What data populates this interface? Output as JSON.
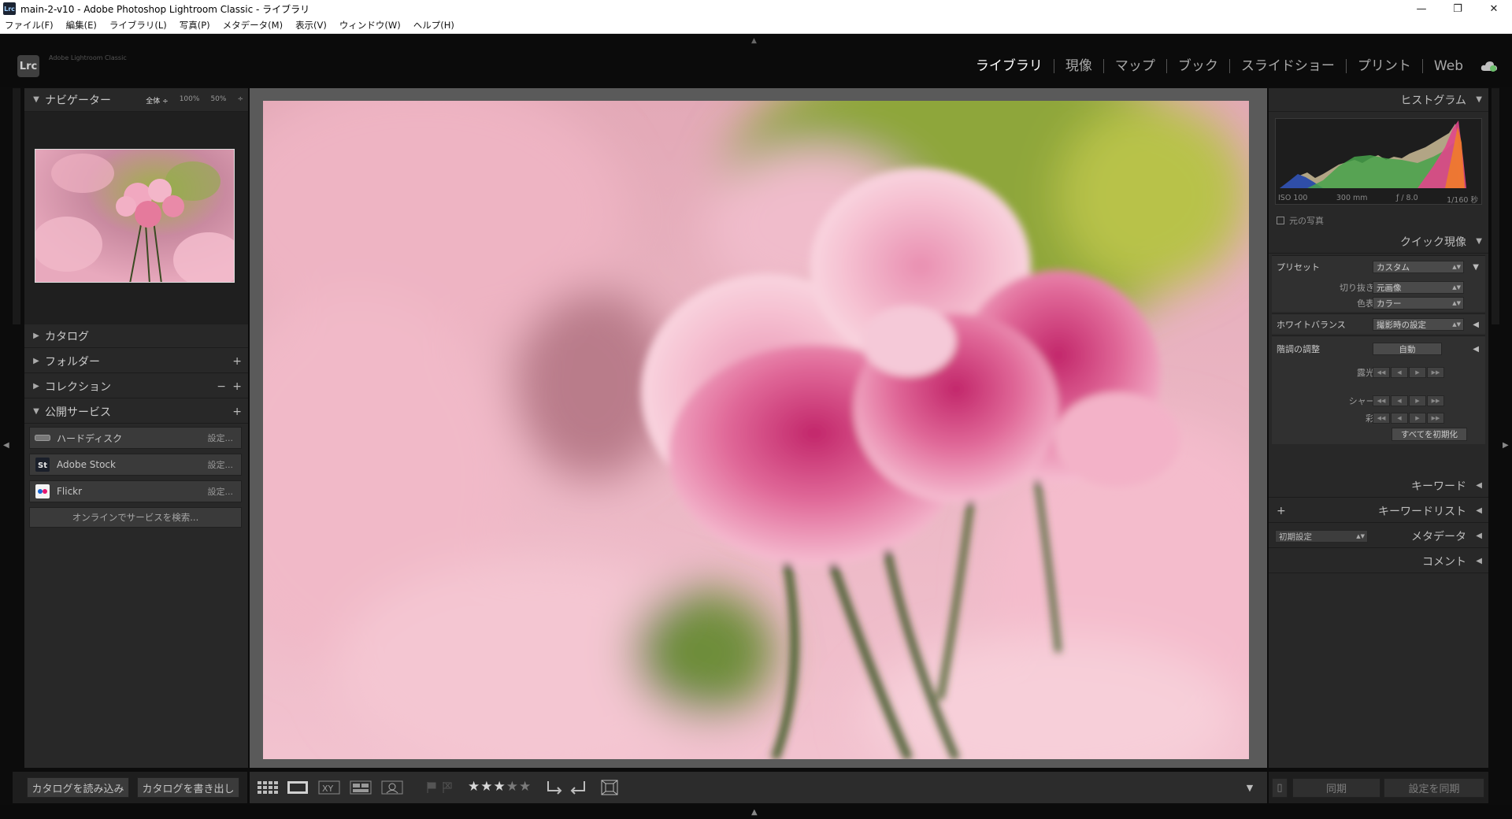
{
  "window": {
    "title": "main-2-v10 - Adobe Photoshop Lightroom Classic - ライブラリ",
    "app_icon": "Lrc",
    "minimize": "—",
    "maximize": "❐",
    "close": "✕"
  },
  "menu": [
    "ファイル(F)",
    "編集(E)",
    "ライブラリ(L)",
    "写真(P)",
    "メタデータ(M)",
    "表示(V)",
    "ウィンドウ(W)",
    "ヘルプ(H)"
  ],
  "identity": {
    "badge": "Lrc",
    "subtitle": "Adobe Lightroom Classic"
  },
  "modules": [
    {
      "label": "ライブラリ",
      "active": true
    },
    {
      "label": "現像",
      "active": false
    },
    {
      "label": "マップ",
      "active": false
    },
    {
      "label": "ブック",
      "active": false
    },
    {
      "label": "スライドショー",
      "active": false
    },
    {
      "label": "プリント",
      "active": false
    },
    {
      "label": "Web",
      "active": false
    }
  ],
  "left": {
    "navigator": {
      "title": "ナビゲーター",
      "zoom_fit": "全体 ÷",
      "zoom_100": "100%",
      "zoom_50": "50%",
      "zoom_arrow": "÷"
    },
    "catalog": "カタログ",
    "folders": "フォルダー",
    "collections": "コレクション",
    "publish": "公開サービス",
    "services": [
      {
        "name": "ハードディスク",
        "setting": "設定..."
      },
      {
        "name": "Adobe Stock",
        "setting": "設定..."
      },
      {
        "name": "Flickr",
        "setting": "設定..."
      }
    ],
    "find_online": "オンラインでサービスを検索...",
    "import_catalog": "カタログを読み込み",
    "export_catalog": "カタログを書き出し"
  },
  "right": {
    "histogram": {
      "title": "ヒストグラム",
      "iso": "ISO 100",
      "focal": "300 mm",
      "aperture": "ƒ / 8.0",
      "shutter": "1/160 秒",
      "original_photo": "元の写真"
    },
    "quick_develop": {
      "title": "クイック現像",
      "preset_label": "プリセット",
      "preset_value": "カスタム",
      "crop_label": "切り抜き比",
      "crop_value": "元画像",
      "treatment_label": "色表現",
      "treatment_value": "カラー",
      "wb_label": "ホワイトバランス",
      "wb_value": "撮影時の設定",
      "tone_label": "階調の調整",
      "auto": "自動",
      "exposure_label": "露光量",
      "sharpen_label": "シャープ",
      "saturation_label": "彩度",
      "reset_all": "すべてを初期化"
    },
    "keywording": "キーワード",
    "keyword_list": "キーワードリスト",
    "metadata": "メタデータ",
    "metadata_preset": "初期設定",
    "comments": "コメント",
    "sync": "同期",
    "sync_settings": "設定を同期"
  },
  "toolbar": {
    "rating": 3,
    "max_rating": 5
  },
  "icons": {
    "grid_view": "grid-icon",
    "loupe_view": "loupe-icon",
    "compare_view": "compare-icon",
    "survey_view": "survey-icon",
    "people_view": "people-icon",
    "rotate_left": "rotate-left-icon",
    "rotate_right": "rotate-right-icon",
    "crop_overlay": "crop-icon"
  },
  "colors": {
    "accent_active": "#ffffff",
    "panel_bg": "#282828",
    "main_bg": "#5a5a5a"
  }
}
